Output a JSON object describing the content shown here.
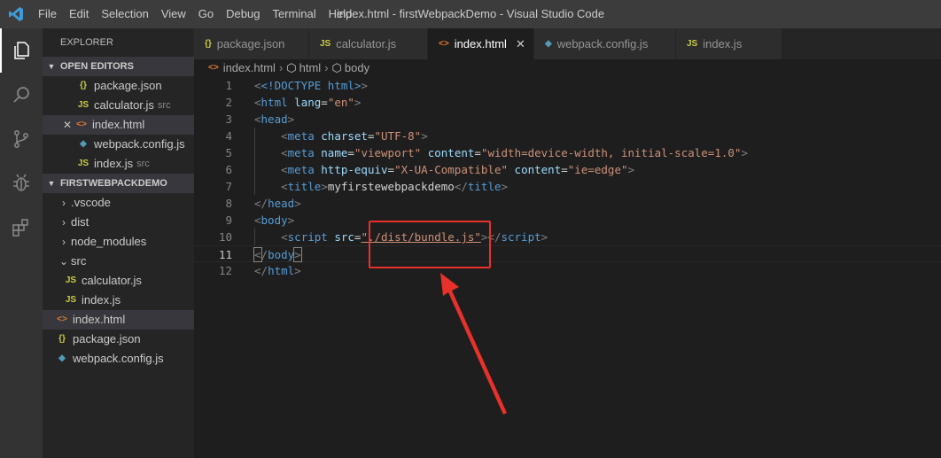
{
  "window": {
    "title": "index.html - firstWebpackDemo - Visual Studio Code"
  },
  "menu": [
    "File",
    "Edit",
    "Selection",
    "View",
    "Go",
    "Debug",
    "Terminal",
    "Help"
  ],
  "activity": [
    "explorer-icon",
    "search-icon",
    "source-control-icon",
    "debug-icon",
    "extensions-icon"
  ],
  "sidebar": {
    "title": "EXPLORER",
    "open_editors_title": "OPEN EDITORS",
    "open_editors": [
      {
        "icon": "{}",
        "name": "package.json",
        "desc": ""
      },
      {
        "icon": "JS",
        "name": "calculator.js",
        "desc": "src"
      },
      {
        "icon": "<>",
        "name": "index.html",
        "desc": ""
      },
      {
        "icon": "◆",
        "name": "webpack.config.js",
        "desc": ""
      },
      {
        "icon": "JS",
        "name": "index.js",
        "desc": "src"
      }
    ],
    "project_title": "FIRSTWEBPACKDEMO",
    "tree": [
      {
        "name": ".vscode"
      },
      {
        "name": "dist"
      },
      {
        "name": "node_modules"
      },
      {
        "name": "src"
      },
      {
        "icon": "JS",
        "name": "calculator.js"
      },
      {
        "icon": "JS",
        "name": "index.js"
      },
      {
        "icon": "<>",
        "name": "index.html"
      },
      {
        "icon": "{}",
        "name": "package.json"
      },
      {
        "icon": "◆",
        "name": "webpack.config.js"
      }
    ]
  },
  "tabs": [
    {
      "icon": "{}",
      "label": "package.json"
    },
    {
      "icon": "JS",
      "label": "calculator.js"
    },
    {
      "icon": "<>",
      "label": "index.html"
    },
    {
      "icon": "◆",
      "label": "webpack.config.js"
    },
    {
      "icon": "JS",
      "label": "index.js"
    }
  ],
  "breadcrumb": {
    "file": "index.html",
    "el1": "html",
    "el2": "body"
  },
  "code_lines": [
    "1",
    "2",
    "3",
    "4",
    "5",
    "6",
    "7",
    "8",
    "9",
    "10",
    "11",
    "12"
  ],
  "code": {
    "doctype": "<!DOCTYPE html>",
    "title_text": "myfirstewebpackdemo",
    "script_src": "\"./dist/bundle.js\""
  }
}
